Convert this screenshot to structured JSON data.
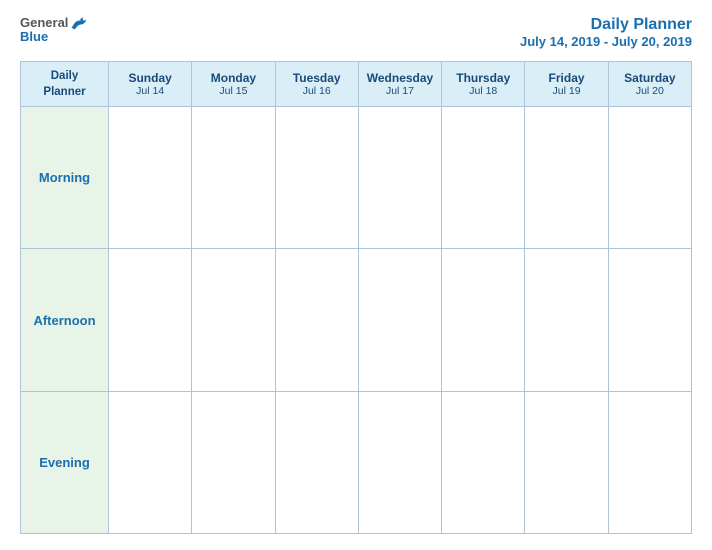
{
  "header": {
    "logo_general": "General",
    "logo_blue": "Blue",
    "title_main": "Daily Planner",
    "title_date": "July 14, 2019 - July 20, 2019"
  },
  "table": {
    "header_label_line1": "Daily",
    "header_label_line2": "Planner",
    "days": [
      {
        "name": "Sunday",
        "date": "Jul 14"
      },
      {
        "name": "Monday",
        "date": "Jul 15"
      },
      {
        "name": "Tuesday",
        "date": "Jul 16"
      },
      {
        "name": "Wednesday",
        "date": "Jul 17"
      },
      {
        "name": "Thursday",
        "date": "Jul 18"
      },
      {
        "name": "Friday",
        "date": "Jul 19"
      },
      {
        "name": "Saturday",
        "date": "Jul 20"
      }
    ],
    "rows": [
      {
        "label": "Morning"
      },
      {
        "label": "Afternoon"
      },
      {
        "label": "Evening"
      }
    ]
  }
}
